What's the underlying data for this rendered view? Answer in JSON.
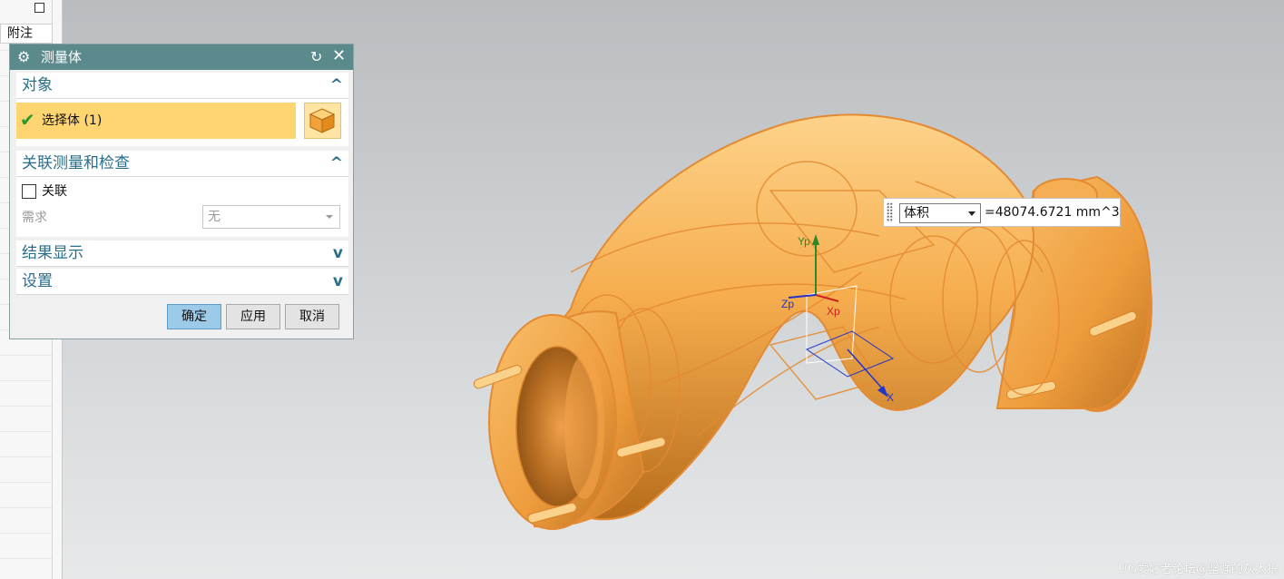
{
  "left_panel": {
    "note_label": "附注"
  },
  "dialog": {
    "title": "测量体",
    "sections": {
      "object": {
        "title": "对象",
        "select_label": "选择体 (1)"
      },
      "assoc": {
        "title": "关联测量和检查",
        "checkbox_label": "关联",
        "checkbox_checked": false,
        "requirement_label": "需求",
        "requirement_value": "无"
      },
      "results": {
        "title": "结果显示"
      },
      "settings": {
        "title": "设置"
      }
    },
    "buttons": {
      "ok": "确定",
      "apply": "应用",
      "cancel": "取消"
    }
  },
  "measure": {
    "type": "体积",
    "value": "=48074.6721 mm^3"
  },
  "axes": {
    "yp": "Yp",
    "zp": "Zp",
    "xp": "Xp",
    "x": "X"
  },
  "watermark": "UG爱好者论坛@坚强的灰太狼",
  "colors": {
    "title_bar": "#5b8a8c",
    "section_text": "#2a6e8a",
    "selection_highlight": "#ffd572",
    "part_orange": "#f4a84a",
    "ok_button": "#9ccbea"
  }
}
